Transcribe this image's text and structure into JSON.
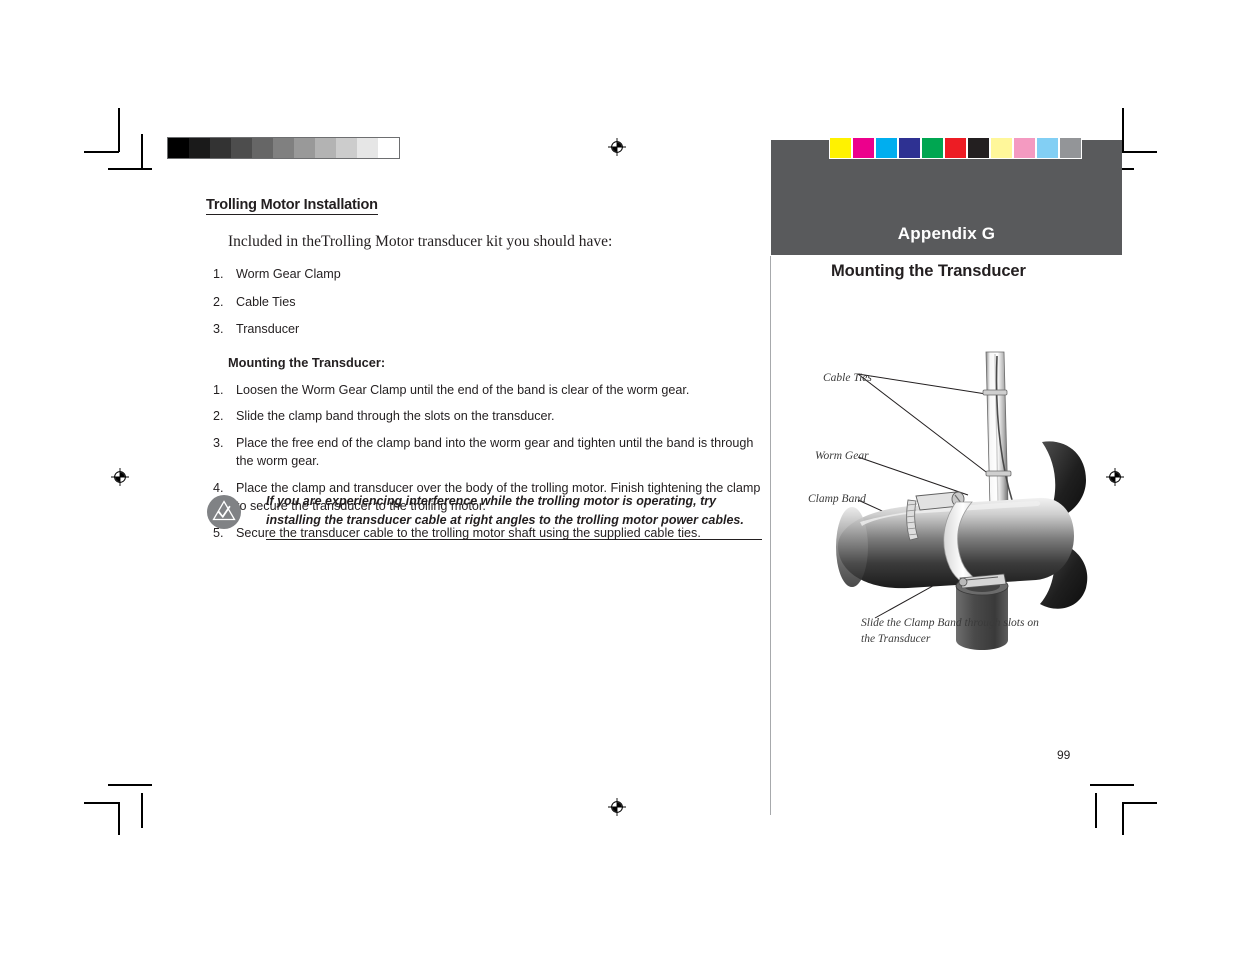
{
  "document": {
    "page_number": "99",
    "section_heading": "Trolling Motor Installation",
    "intro_line": "Included in theTrolling Motor transducer kit you should have:",
    "mounting_subhead": "Mounting the Transducer:",
    "kit_list": [
      {
        "num": "1.",
        "text": "Worm Gear Clamp"
      },
      {
        "num": "2.",
        "text": "Cable Ties"
      },
      {
        "num": "3.",
        "text": "Transducer"
      }
    ],
    "mounting_steps": [
      {
        "num": "1.",
        "text": "Loosen the Worm Gear Clamp until the end of the band is clear of the worm gear."
      },
      {
        "num": "2.",
        "text": "Slide the clamp band through the slots on the transducer."
      },
      {
        "num": "3.",
        "text": "Place the free end of the clamp band into the worm gear and tighten until the band is through the worm gear."
      },
      {
        "num": "4.",
        "text": "Place the clamp and transducer over the body of the trolling motor. Finish tightening the clamp to secure the transducer to the trolling motor."
      },
      {
        "num": "5.",
        "text": "Secure the transducer cable to the trolling motor shaft using the supplied cable ties."
      }
    ],
    "note": {
      "icon": "garmin-note-icon",
      "text": "If you are experiencing interference while the trolling motor is operating, try installing the transducer cable at right angles to the trolling motor power cables."
    }
  },
  "sidebar": {
    "appendix_label": "Appendix G",
    "heading": "Mounting the Transducer",
    "figure": {
      "name": "trolling-motor-transducer-diagram",
      "callouts": [
        {
          "label": "Cable Ties"
        },
        {
          "label": "Worm Gear"
        },
        {
          "label": "Clamp Band"
        }
      ],
      "caption": "Slide the Clamp Band through slots on the Transducer"
    }
  },
  "print_marks": {
    "grayscale_patches": [
      "#000000",
      "#1a1a1a",
      "#333333",
      "#4d4d4d",
      "#666666",
      "#808080",
      "#999999",
      "#b3b3b3",
      "#cccccc",
      "#e6e6e6",
      "#ffffff"
    ],
    "color_patches": [
      "#fff200",
      "#ec008c",
      "#00aeef",
      "#2e3192",
      "#00a651",
      "#ed1c24",
      "#231f20",
      "#fff79a",
      "#f49ac1",
      "#82cff4",
      "#939598"
    ],
    "banner_color": "#595a5c",
    "registration_mark": "registration-target-icon"
  }
}
